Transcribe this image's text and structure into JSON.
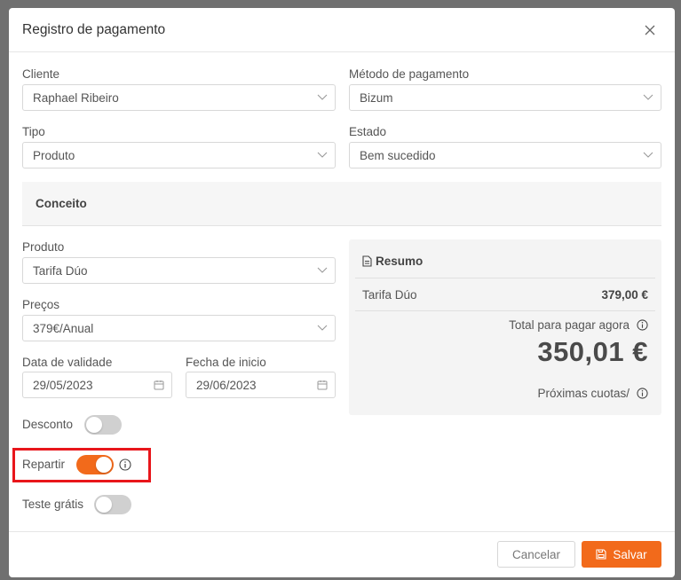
{
  "modal": {
    "title": "Registro de pagamento"
  },
  "fields": {
    "cliente": {
      "label": "Cliente",
      "value": "Raphael Ribeiro"
    },
    "metodo": {
      "label": "Método de pagamento",
      "value": "Bizum"
    },
    "tipo": {
      "label": "Tipo",
      "value": "Produto"
    },
    "estado": {
      "label": "Estado",
      "value": "Bem sucedido"
    },
    "produto": {
      "label": "Produto",
      "value": "Tarifa Dúo"
    },
    "precos": {
      "label": "Preços",
      "value": "379€/Anual"
    },
    "validade": {
      "label": "Data de validade",
      "value": "29/05/2023"
    },
    "inicio": {
      "label": "Fecha de inicio",
      "value": "29/06/2023"
    }
  },
  "concept": {
    "title": "Conceito"
  },
  "toggles": {
    "desconto": {
      "label": "Desconto",
      "on": false
    },
    "repartir": {
      "label": "Repartir",
      "on": true
    },
    "teste": {
      "label": "Teste grátis",
      "on": false
    }
  },
  "summary": {
    "title": "Resumo",
    "item_name": "Tarifa Dúo",
    "item_price": "379,00 €",
    "total_label": "Total para pagar agora",
    "total_amount": "350,01 €",
    "next_label": "Próximas cuotas/"
  },
  "footer": {
    "cancel_label": "Cancelar",
    "save_label": "Salvar"
  },
  "colors": {
    "accent": "#f26a1b",
    "highlight": "#e8161b"
  },
  "icons": [
    "close-icon",
    "chevron-down-icon",
    "calendar-icon",
    "info-icon",
    "document-icon",
    "save-icon"
  ]
}
